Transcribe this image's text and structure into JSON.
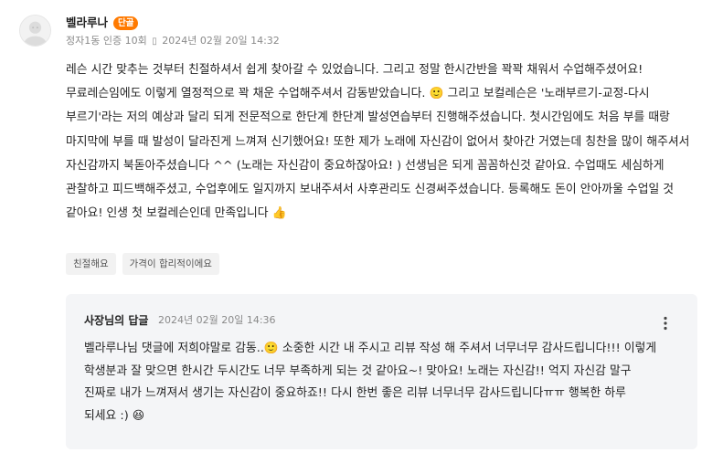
{
  "review": {
    "user_name": "벨라루나",
    "badge": "단골",
    "meta": {
      "location": "정자1동 인증",
      "visits": "10회",
      "date": "2024년 02월 20일 14:32"
    },
    "body": "레슨 시간 맞추는 것부터 친절하셔서 쉽게 찾아갈 수 있었습니다. 그리고 정말 한시간반을 꽉꽉 채워서 수업해주셨어요! 무료레슨임에도 이렇게 열정적으로 꽉 채운 수업해주셔서 감동받았습니다. 🙂 그리고 보컬레슨은 '노래부르기-교정-다시 부르기'라는 저의 예상과 달리 되게 전문적으로 한단계 한단계 발성연습부터 진행해주셨습니다. 첫시간임에도 처음 부를 때랑 마지막에 부를 때 발성이 달라진게 느껴져 신기했어요! 또한 제가 노래에 자신감이 없어서 찾아간 거였는데 칭찬을 많이 해주셔서 자신감까지 북돋아주셨습니다 ^^ (노래는 자신감이 중요하잖아요! ) 선생님은 되게 꼼꼼하신것 같아요. 수업때도 세심하게 관찰하고 피드백해주셨고, 수업후에도 일지까지 보내주셔서 사후관리도 신경써주셨습니다. 등록해도 돈이 안아까울 수업일 것 같아요! 인생 첫 보컬레슨인데 만족입니다 👍",
    "tags": [
      "친절해요",
      "가격이 합리적이에요"
    ]
  },
  "owner_reply": {
    "author": "사장님의 답글",
    "date": "2024년 02월 20일 14:36",
    "body": "벨라루나님 댓글에 저희야말로 감동..🙂 소중한 시간 내 주시고 리뷰 작성 해 주셔서 너무너무 감사드립니다!!! 이렇게 학생분과 잘 맞으면 한시간 두시간도 너무 부족하게 되는 것 같아요~! 맞아요! 노래는 자신감!! 억지 자신감 말구 진짜로 내가 느껴져서 생기는 자신감이 중요하죠!! 다시 한번 좋은 리뷰 너무너무 감사드립니다ㅠㅠ 행복한 하루 되세요 :) 😆",
    "more_icon": "more-vertical-icon"
  },
  "colors": {
    "badge": "#ff7a00",
    "reply_background": "#f4f5f7",
    "tag_background": "#f2f2f2",
    "meta_text": "#8a8a8a"
  }
}
